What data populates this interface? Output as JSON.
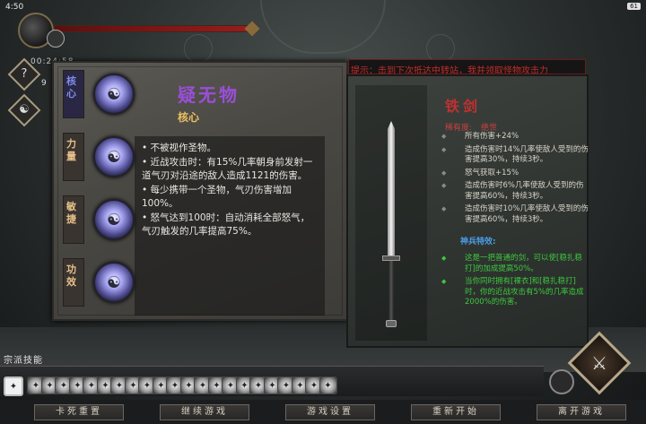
{
  "status_bar": {
    "time": "4:50",
    "battery": "61"
  },
  "hud": {
    "run_timer": "00:24:58",
    "help_button": "?",
    "stat_value": "9"
  },
  "skill_panel": {
    "slots": [
      {
        "label": "核心",
        "active": true
      },
      {
        "label": "力量",
        "active": false
      },
      {
        "label": "敏捷",
        "active": false
      },
      {
        "label": "功效",
        "active": false
      }
    ],
    "skill_name": "疑无物",
    "skill_type": "核心",
    "description": [
      "• 不被视作圣物。",
      "• 近战攻击时：有15%几率朝身前发射一道气刃对沿途的敌人造成1121的伤害。",
      "• 每少携带一个圣物，气刃伤害增加100%。",
      "• 怒气达到100时：自动消耗全部怒气，气刃触发的几率提高75%。"
    ]
  },
  "item_panel": {
    "notice": "提示：击到下次抵达中转站，我并领取怪物攻击力",
    "item_name": "铁剑",
    "rarity_label": "稀有度:",
    "rarity_value": "绝世",
    "attributes": [
      "所有伤害+24%",
      "造成伤害时14%几率使敌人受到的伤害提高30%，持续3秒。",
      "怒气获取+15%",
      "造成伤害时6%几率使敌人受到的伤害提高60%，持续3秒。",
      "造成伤害时10%几率使敌人受到的伤害提高60%，持续3秒。"
    ],
    "special_title": "神兵特效:",
    "specials": [
      "这是一把普通的剑，可以使[稳扎稳打]的加成提高50%。",
      "当你同时拥有[裸衣]和[稳扎稳打]时，你的近战攻击有5%的几率造成2000%的伤害。"
    ]
  },
  "skills_bar": {
    "title": "宗派技能",
    "icons": [
      "sword-skill",
      "blade-skill",
      "whirl-skill",
      "strike-skill",
      "dash-skill",
      "slash-skill",
      "claw-skill",
      "spear-skill",
      "swing-skill",
      "bow-skill",
      "sweep-skill",
      "orb-skill",
      "fist-skill",
      "ring-skill",
      "star-skill",
      "eye-skill",
      "wing-skill",
      "thrust-skill",
      "crest-skill",
      "flame-skill",
      "cloud-skill",
      "moon-skill",
      "hammer-skill"
    ]
  },
  "menu": {
    "buttons": [
      "卡死重置",
      "继续游戏",
      "游戏设置",
      "重新开始",
      "离开游戏"
    ]
  }
}
